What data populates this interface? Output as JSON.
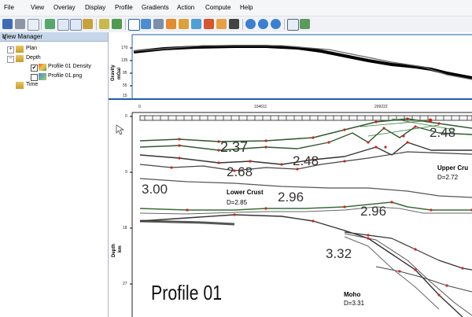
{
  "menu": {
    "items": [
      "File",
      "View",
      "Overlay",
      "Display",
      "Profile",
      "Gradients",
      "Action",
      "Compute",
      "Help"
    ]
  },
  "colors": {
    "menubar_bg": "#f5f6f8",
    "panel_title_bg": "#c6d7ea",
    "frame_blue": "#1f5fa8",
    "gravity_line": "#000000",
    "horizon_green": "#3a6b3a",
    "point_red": "#d62020"
  },
  "toolbar": {
    "icons": [
      "save-icon",
      "print-icon",
      "undo-icon",
      "new-profile-icon",
      "zoom-window-icon",
      "zoom-out-icon",
      "layers-icon",
      "grid-icon",
      "pointer-icon",
      "edit-body-icon",
      "link-icon",
      "select-icon",
      "rotate-icon",
      "pencil-icon",
      "show-icon",
      "zoom-in-icon",
      "zoom-minus-icon",
      "pan-icon",
      "copy-icon",
      "map-icon"
    ]
  },
  "view_manager": {
    "title": "View Manager",
    "pin": "ɋ",
    "tree": [
      {
        "label": "Plan",
        "level": 0,
        "expander": "+"
      },
      {
        "label": "Depth",
        "level": 0,
        "expander": "−"
      },
      {
        "label": "Profile 01 Density",
        "level": 1,
        "checked": true
      },
      {
        "label": "Profile 01.png",
        "level": 1,
        "checked": false
      },
      {
        "label": "Time",
        "level": 0
      }
    ]
  },
  "gravity_panel": {
    "axis_label_line1": "Gravity",
    "axis_label_line2": "mGal",
    "y_ticks": [
      "170",
      "135",
      "95",
      "55",
      "15"
    ]
  },
  "section_panel": {
    "x_ticks": [
      "0",
      "104611",
      "209222"
    ],
    "axis_label_line1": "Depth",
    "axis_label_line2": "km",
    "y_ticks": [
      "0",
      "9",
      "18",
      "27"
    ]
  },
  "image_annotations": {
    "profile_title": "Profile 01",
    "density_values": [
      "2.37",
      "2.68",
      "2.48",
      "2.48",
      "3.00",
      "2.96",
      "2.96",
      "3.32"
    ],
    "labels": [
      {
        "name": "Upper Cru",
        "density": "D=2.72"
      },
      {
        "name": "Lower Crust",
        "density": "D=2.85"
      },
      {
        "name": "Moho",
        "density": "D=3.31"
      }
    ]
  }
}
